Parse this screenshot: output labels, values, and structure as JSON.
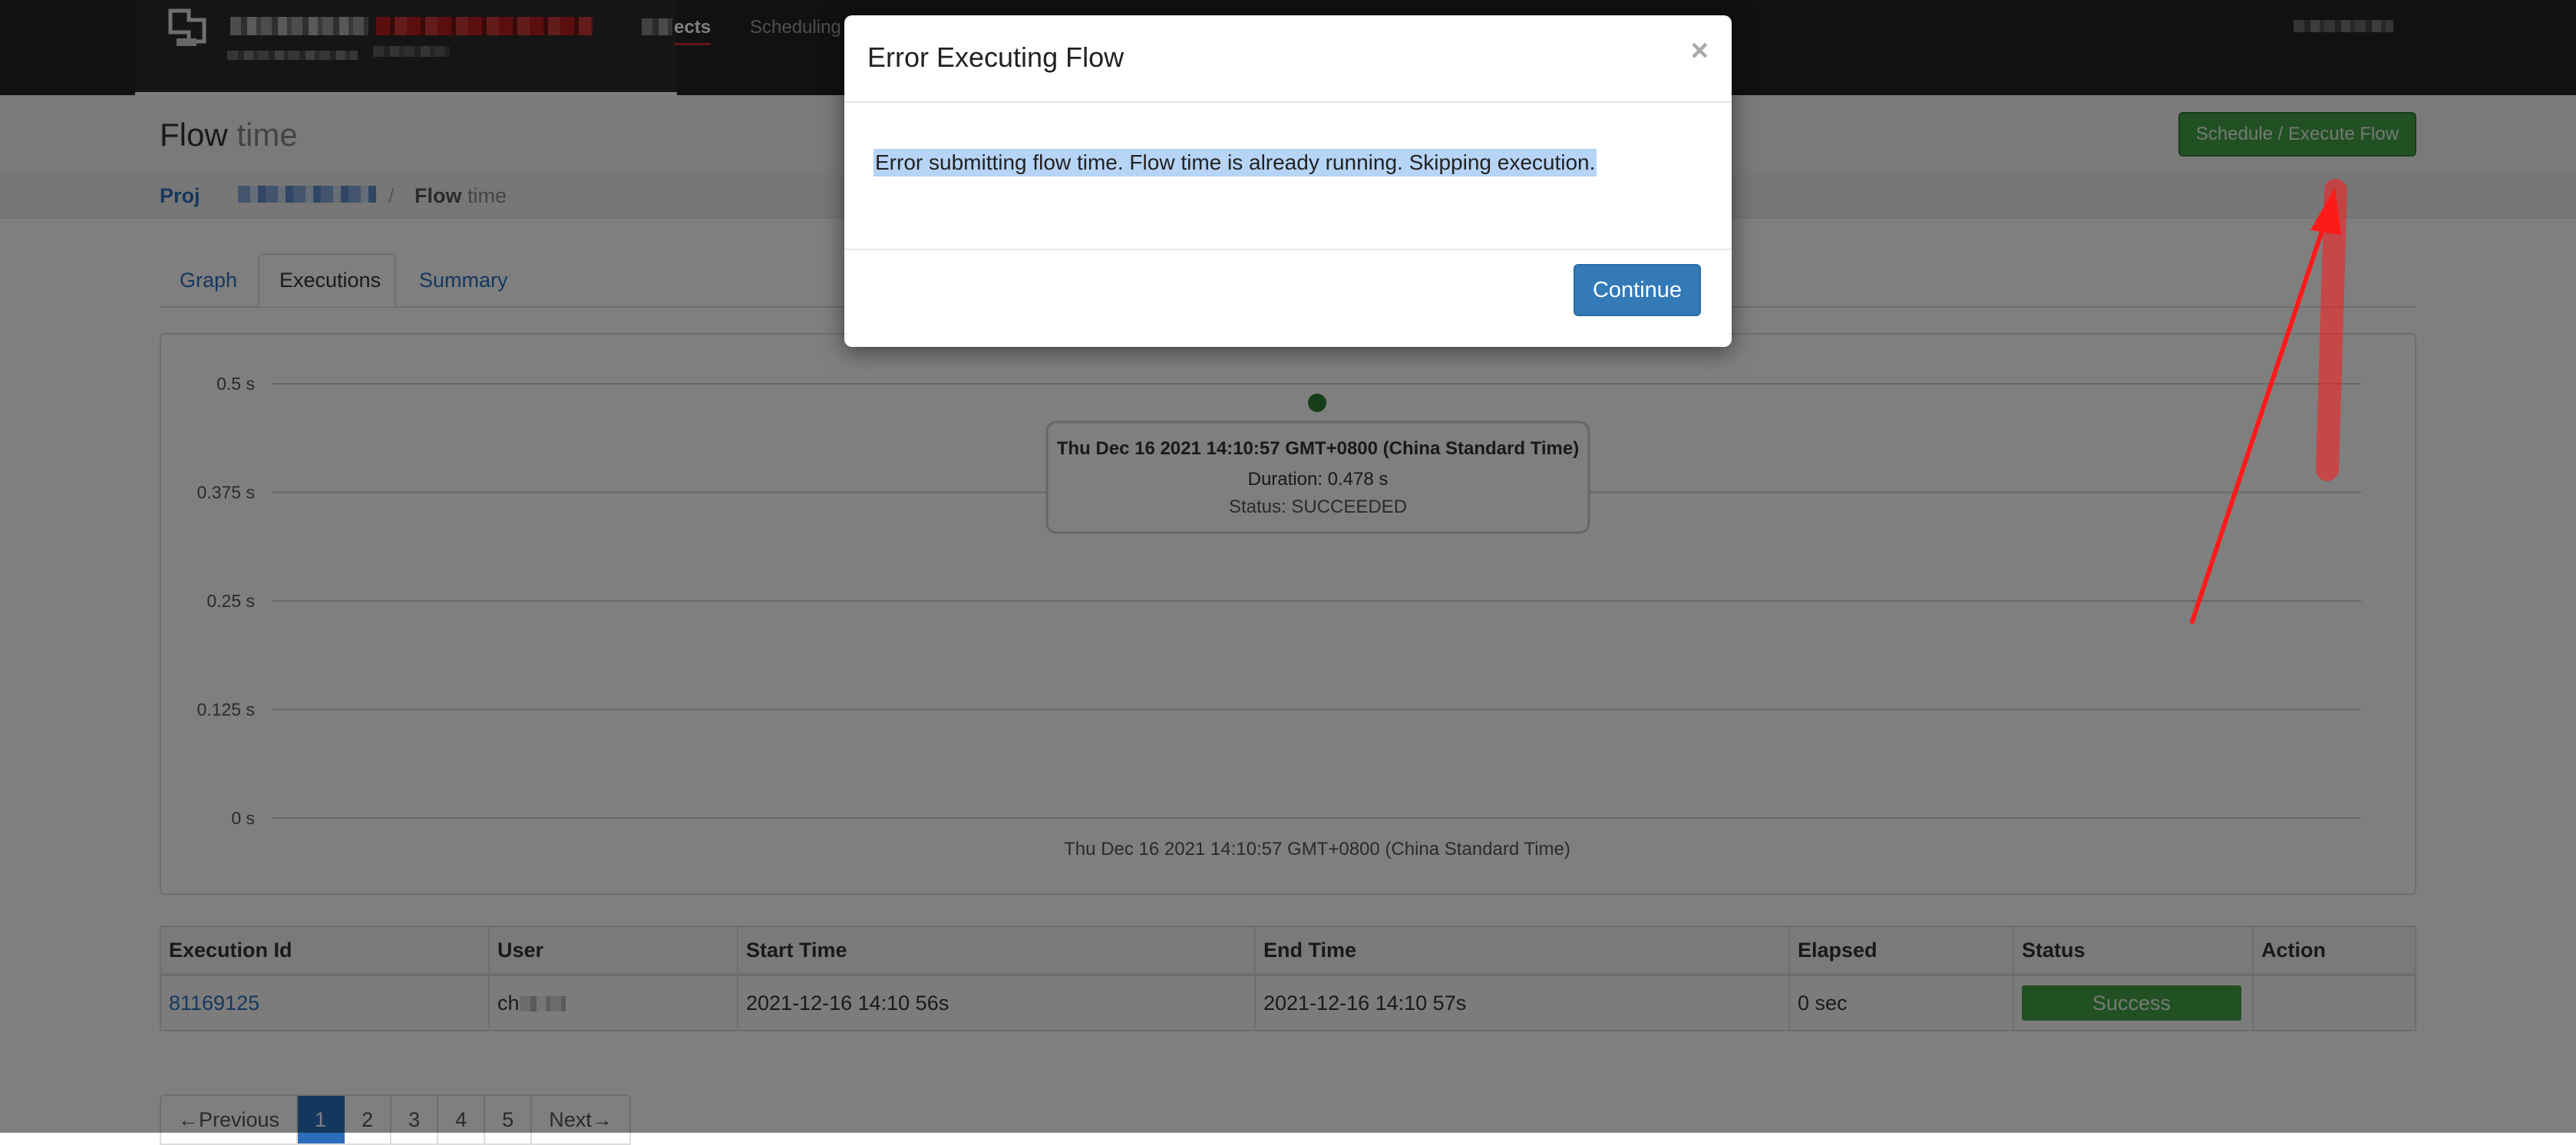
{
  "nav": {
    "items": [
      {
        "label": "ects",
        "active": true
      },
      {
        "label": "Scheduling",
        "active": false
      }
    ]
  },
  "header": {
    "title_main": "Flow",
    "title_sub": "time",
    "execute_button": "Schedule / Execute Flow"
  },
  "breadcrumb": {
    "project": "Proj",
    "separator": "/",
    "flow_main": "Flow",
    "flow_sub": "time"
  },
  "tabs": [
    {
      "label": "Graph",
      "active": false
    },
    {
      "label": "Executions",
      "active": true
    },
    {
      "label": "Summary",
      "active": false
    }
  ],
  "chart_data": {
    "type": "scatter",
    "y_ticks": [
      "0.5 s",
      "0.375 s",
      "0.25 s",
      "0.125 s",
      "0 s"
    ],
    "y_tick_values": [
      0.5,
      0.375,
      0.25,
      0.125,
      0
    ],
    "ylim": [
      0,
      0.5
    ],
    "x_label": "Thu Dec 16 2021 14:10:57 GMT+0800 (China Standard Time)",
    "points": [
      {
        "x": "Thu Dec 16 2021 14:10:57 GMT+0800 (China Standard Time)",
        "y": 0.478,
        "status": "SUCCEEDED"
      }
    ],
    "point_color": "#2e7d32",
    "grid": true,
    "tooltip": {
      "title": "Thu Dec 16 2021 14:10:57 GMT+0800 (China Standard Time)",
      "duration": "Duration: 0.478 s",
      "status": "Status: SUCCEEDED"
    }
  },
  "table": {
    "headers": [
      "Execution Id",
      "User",
      "Start Time",
      "End Time",
      "Elapsed",
      "Status",
      "Action"
    ],
    "rows": [
      {
        "id": "81169125",
        "user": "ch",
        "start": "2021-12-16 14:10 56s",
        "end": "2021-12-16 14:10 57s",
        "elapsed": "0 sec",
        "status": "Success",
        "action": ""
      }
    ]
  },
  "pagination": {
    "prev": "←Previous",
    "pages": [
      "1",
      "2",
      "3",
      "4",
      "5"
    ],
    "current": "1",
    "next": "Next→"
  },
  "modal": {
    "title": "Error Executing Flow",
    "close": "×",
    "message": "Error submitting flow time. Flow time is already running. Skipping execution.",
    "button": "Continue"
  },
  "colors": {
    "success": "#43a047",
    "link": "#2a6ebb",
    "primary": "#337ab7",
    "annotation": "#ff1a1a"
  }
}
